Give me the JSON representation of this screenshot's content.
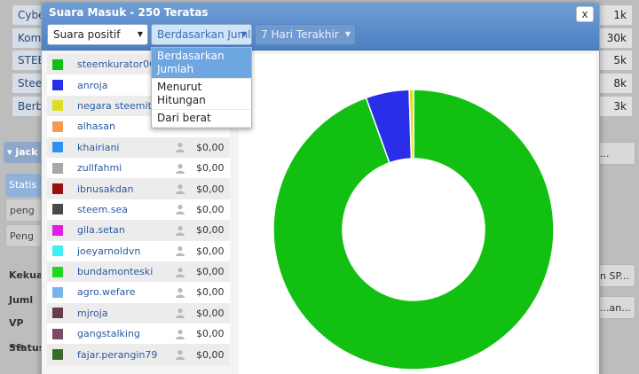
{
  "background": {
    "left_rows": [
      "Cyber",
      "Kom",
      "STEE",
      "Stee",
      "Berb"
    ],
    "right_values": [
      "1k",
      "30k",
      "5k",
      "8k",
      "3k"
    ],
    "user_label": "jack",
    "left_stats": [
      "Statis",
      "peng",
      "Peng"
    ],
    "left_bold": [
      "Kekua",
      "Juml",
      "VP ~>",
      "Status"
    ],
    "right_buttons": [
      "...",
      "n SP...",
      "...an..."
    ]
  },
  "modal": {
    "title": "Suara Masuk - 250 Teratas",
    "close_label": "x",
    "filter_type": "Suara positif",
    "sort_by": "Berdasarkan Jumlah",
    "period": "7 Hari Terakhir",
    "sort_options": [
      "Berdasarkan Jumlah",
      "Menurut Hitungan",
      "Dari berat"
    ]
  },
  "voters": [
    {
      "name": "steemkurator06",
      "color": "#12c012",
      "amount": ""
    },
    {
      "name": "anroja",
      "color": "#2a2ee8",
      "amount": ""
    },
    {
      "name": "negara steemit",
      "color": "#dddd22",
      "amount": ""
    },
    {
      "name": "alhasan",
      "color": "#f59a50",
      "amount": ""
    },
    {
      "name": "khairiani",
      "color": "#2f90ee",
      "amount": "$0,00"
    },
    {
      "name": "zullfahmi",
      "color": "#a8a8a8",
      "amount": "$0,00"
    },
    {
      "name": "ibnusakdan",
      "color": "#9a0e0e",
      "amount": "$0,00"
    },
    {
      "name": "steem.sea",
      "color": "#4a4a4a",
      "amount": "$0,00"
    },
    {
      "name": "gila.setan",
      "color": "#e01ee0",
      "amount": "$0,00"
    },
    {
      "name": "joeyarnoldvn",
      "color": "#44eeee",
      "amount": "$0,00"
    },
    {
      "name": "bundamonteski",
      "color": "#20d820",
      "amount": "$0,00"
    },
    {
      "name": "agro.wefare",
      "color": "#78b4e8",
      "amount": "$0,00"
    },
    {
      "name": "mjroja",
      "color": "#6a3c50",
      "amount": "$0,00"
    },
    {
      "name": "gangstalking",
      "color": "#7a4a66",
      "amount": "$0,00"
    },
    {
      "name": "fajar.perangin79",
      "color": "#3a6a28",
      "amount": "$0,00"
    }
  ],
  "chart_data": {
    "type": "pie",
    "donut": true,
    "slices": [
      {
        "label": "steemkurator06",
        "value": 94.5,
        "color": "#12c012"
      },
      {
        "label": "anroja",
        "value": 5.0,
        "color": "#2a2ee8"
      },
      {
        "label": "negara steemit",
        "value": 0.5,
        "color": "#dddd22"
      }
    ]
  }
}
